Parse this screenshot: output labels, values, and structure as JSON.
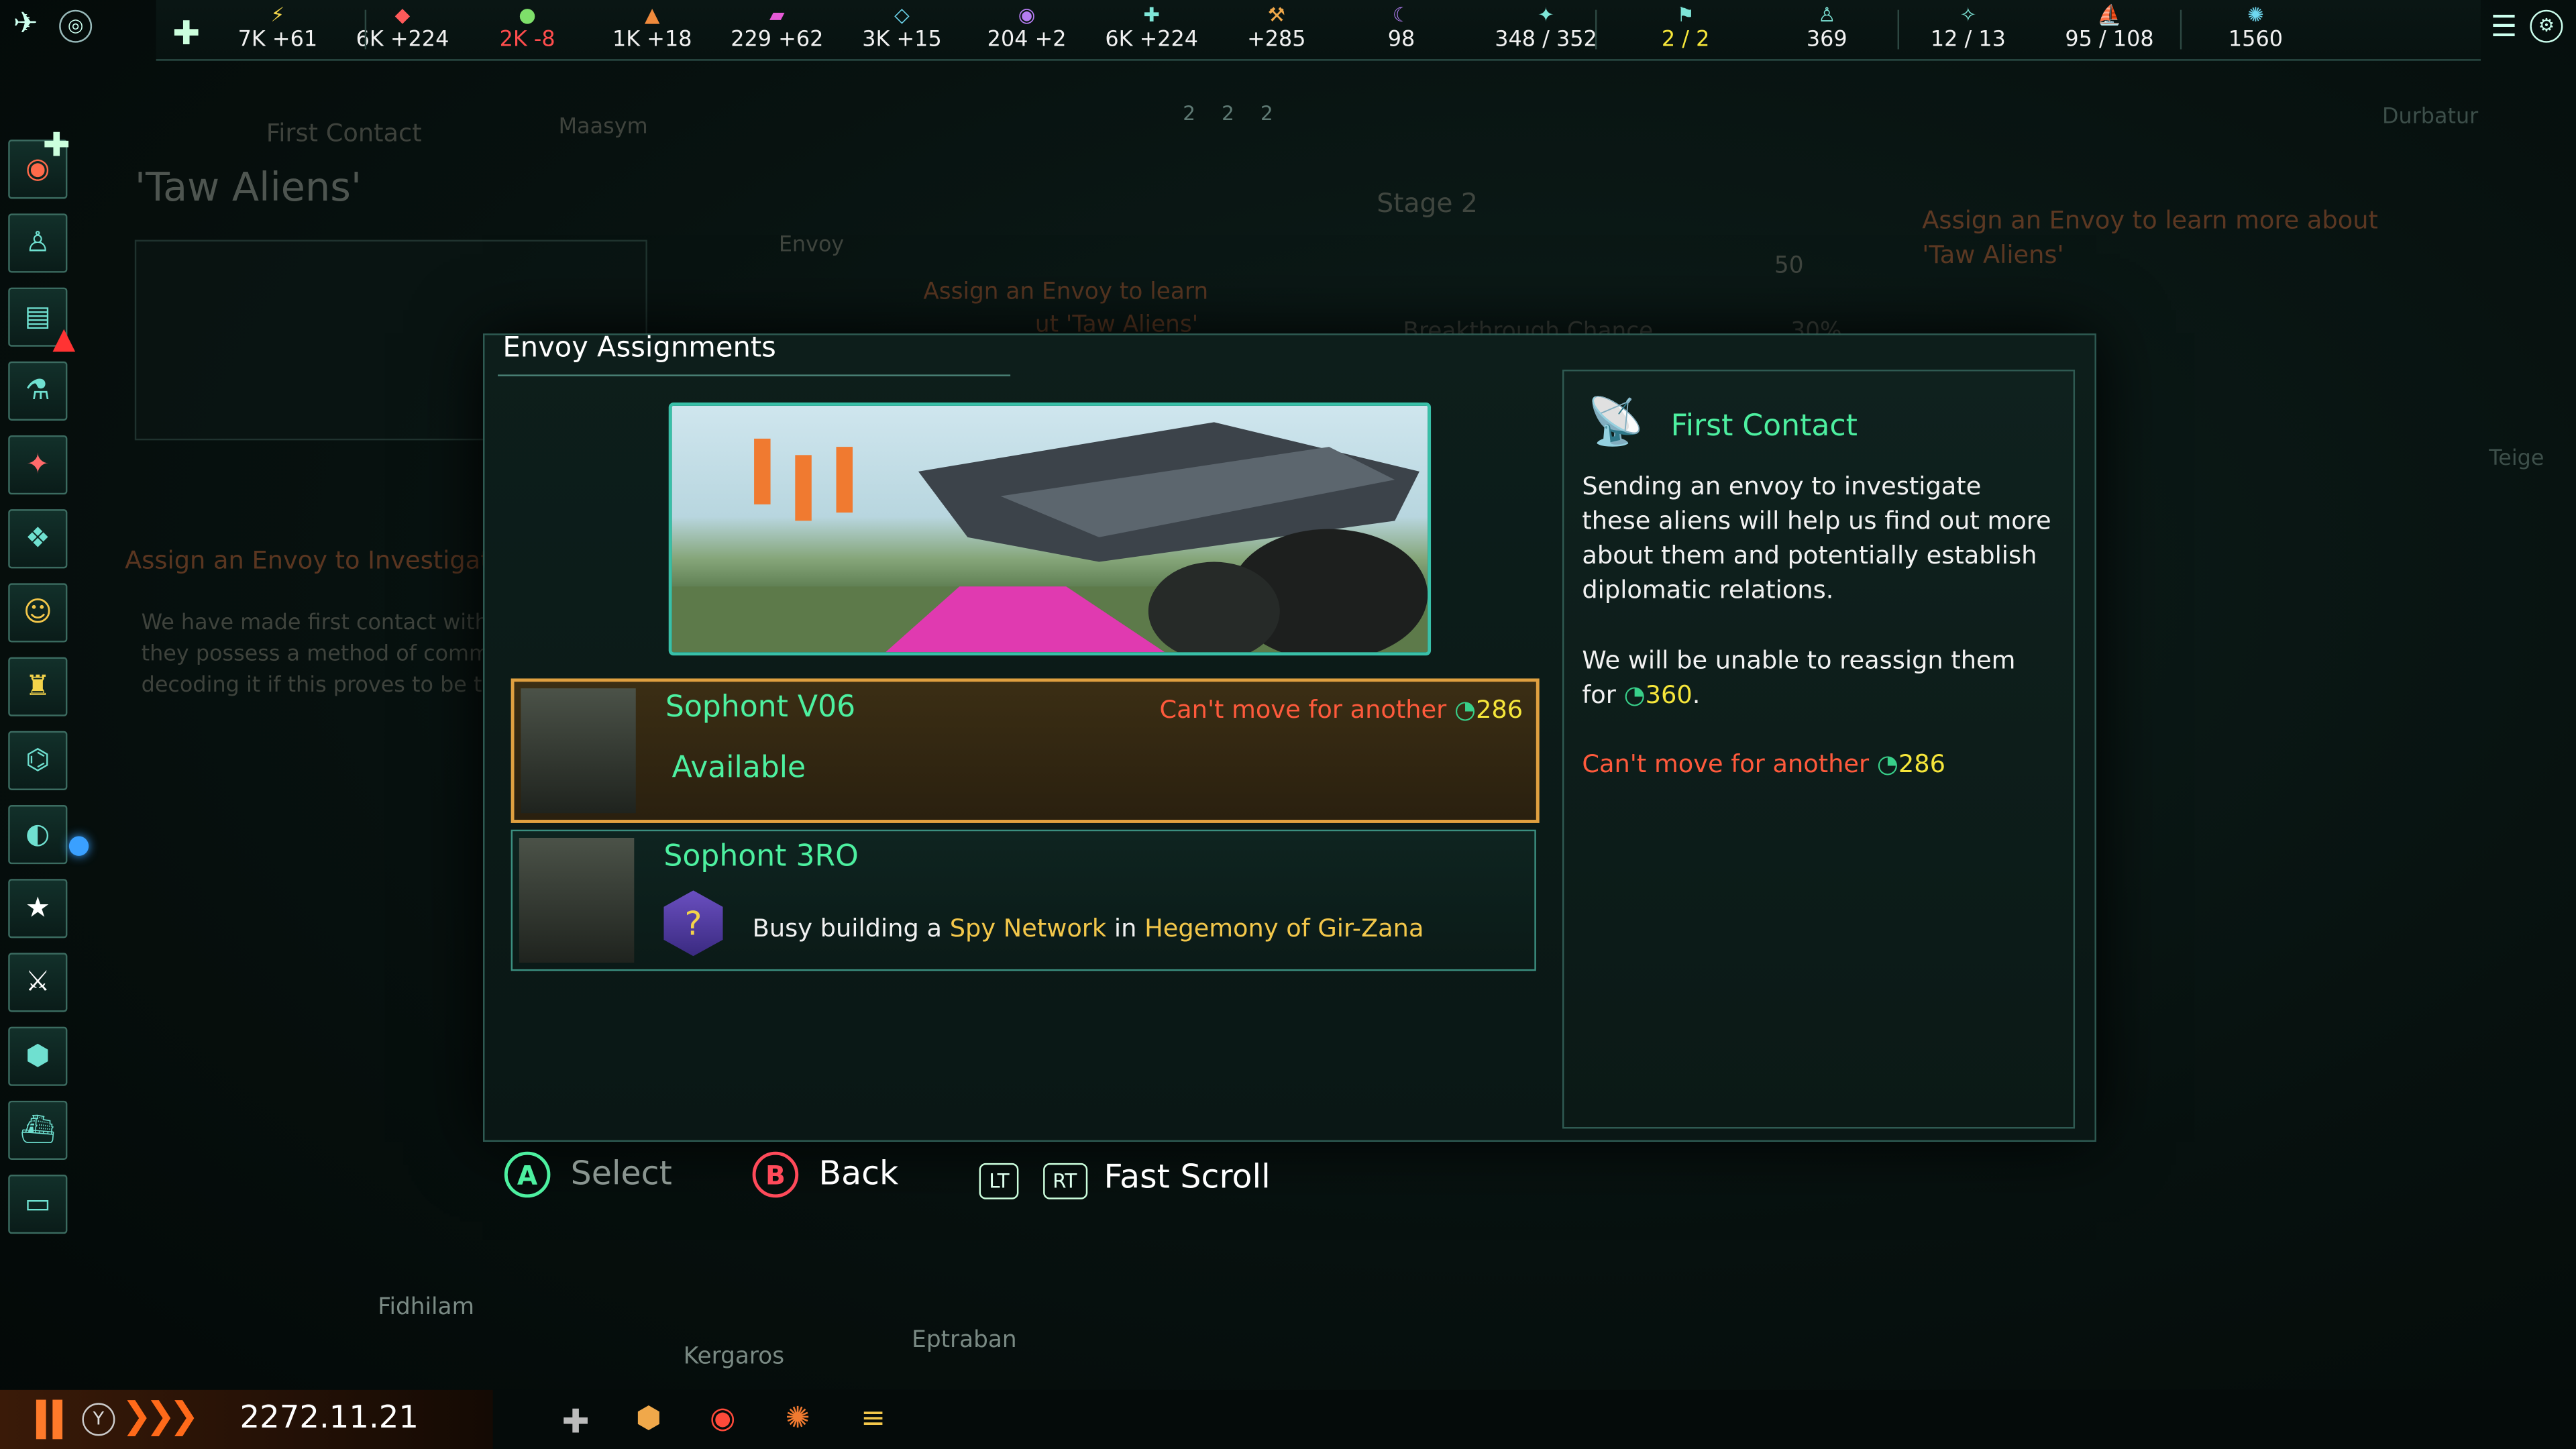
{
  "topbar": {
    "resources": [
      {
        "icon": "energy-icon",
        "glyph": "⚡",
        "color": "#f4d64b",
        "value": "7K +61",
        "value_color": "#f1f1f1"
      },
      {
        "icon": "minerals-icon",
        "glyph": "◆",
        "color": "#ff5a5a",
        "value": "6K +224",
        "value_color": "#f1f1f1"
      },
      {
        "icon": "food-icon",
        "glyph": "●",
        "color": "#7ee06a",
        "value": "2K -8",
        "value_color": "#ff4d4d"
      },
      {
        "icon": "consumer-goods-icon",
        "glyph": "▲",
        "color": "#f08a3c",
        "value": "1K +18",
        "value_color": "#f1f1f1"
      },
      {
        "icon": "alloys-icon",
        "glyph": "▰",
        "color": "#e55ad6",
        "value": "229 +62",
        "value_color": "#f1f1f1"
      },
      {
        "icon": "influence-icon",
        "glyph": "◇",
        "color": "#6ed8f0",
        "value": "3K +15",
        "value_color": "#f1f1f1"
      },
      {
        "icon": "unity-icon",
        "glyph": "◉",
        "color": "#b57cf2",
        "value": "204 +2",
        "value_color": "#f1f1f1"
      },
      {
        "icon": "trade-icon",
        "glyph": "✚",
        "color": "#7ee6d8",
        "value": "6K +224",
        "value_color": "#f1f1f1"
      },
      {
        "icon": "research-icon",
        "glyph": "⚒",
        "color": "#f0a84a",
        "value": "+285",
        "value_color": "#f1f1f1"
      },
      {
        "icon": "artifact-icon",
        "glyph": "☾",
        "color": "#b07cf2",
        "value": "98",
        "value_color": "#f1f1f1"
      },
      {
        "icon": "fleet-capacity-icon",
        "glyph": "✦",
        "color": "#7ee6d8",
        "value": "348 / 352",
        "value_color": "#f1f1f1"
      },
      {
        "icon": "envoy-icon",
        "glyph": "⚑",
        "color": "#7ee6d8",
        "value": "2 / 2",
        "value_color": "#f6e63a"
      },
      {
        "icon": "population-icon",
        "glyph": "♙",
        "color": "#7ee6d8",
        "value": "369",
        "value_color": "#f1f1f1"
      },
      {
        "icon": "starbase-icon",
        "glyph": "✧",
        "color": "#7ee6d8",
        "value": "12 / 13",
        "value_color": "#f1f1f1"
      },
      {
        "icon": "ships-icon",
        "glyph": "⛵",
        "color": "#7ee6d8",
        "value": "95 / 108",
        "value_color": "#f1f1f1"
      },
      {
        "icon": "fleet-power-icon",
        "glyph": "✺",
        "color": "#6ed8f0",
        "value": "1560",
        "value_color": "#f1f1f1"
      }
    ],
    "sub_counts": [
      "2",
      "2",
      "2"
    ]
  },
  "background": {
    "first_contact_label": "First Contact",
    "species_title": "'Taw Aliens'",
    "system_name": "Maasym",
    "envoy_label": "Envoy",
    "assign_envoy_short": "Assign an Envoy to learn",
    "assign_envoy_short2": "ut 'Taw Aliens'",
    "assign_to_investigate": "Assign an Envoy to Investigate",
    "body_text_1": "We have made first contact with",
    "body_text_2": "they possess a method of comm",
    "body_text_3": "decoding it if this proves to be t",
    "stage_label": "Stage 2",
    "stage_value": "50",
    "breakthrough_label": "Breakthrough Chance",
    "breakthrough_value": "30%",
    "right_hint": "Assign an Envoy to learn more about 'Taw Aliens'",
    "map_labels": [
      "Durbatur",
      "Fidhilam",
      "Kergaros",
      "Eptraban",
      "Teige"
    ]
  },
  "modal": {
    "title": "Envoy Assignments",
    "envoys": [
      {
        "name": "Sophont V06",
        "status": "Available",
        "cooldown_label": "Can't move for another",
        "cooldown_value": "286",
        "selected": true
      },
      {
        "name": "Sophont 3RO",
        "busy_prefix": "Busy building a",
        "busy_project": "Spy Network",
        "busy_in": "in",
        "busy_target": "Hegemony of Gir-Zana",
        "selected": false
      }
    ],
    "info": {
      "title": "First Contact",
      "description": "Sending an envoy to investigate these aliens will help us find out more about them and potentially establish diplomatic relations.",
      "reassign_text": "We will be unable to reassign them for",
      "reassign_value": "360",
      "reassign_period": ".",
      "cooldown_label": "Can't move for another",
      "cooldown_value": "286"
    }
  },
  "hints": {
    "select_key": "A",
    "select_label": "Select",
    "back_key": "B",
    "back_label": "Back",
    "lt_key": "LT",
    "rt_key": "RT",
    "fast_scroll_label": "Fast Scroll"
  },
  "bottombar": {
    "date": "2272.11.21",
    "speed_key": "Y"
  },
  "colors": {
    "accent": "#39c0a8",
    "selected_border": "#e0a040",
    "warning": "#ff5a3c",
    "highlight": "#f6e63a",
    "title_green": "#4df0a0"
  }
}
